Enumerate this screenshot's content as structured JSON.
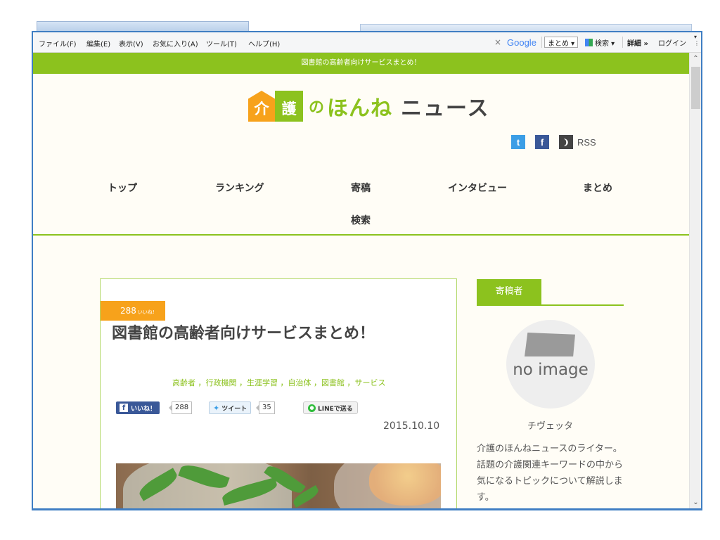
{
  "browser": {
    "menu": [
      "ファイル(F)",
      "編集(E)",
      "表示(V)",
      "お気に入り(A)",
      "ツール(T)",
      "ヘルプ(H)"
    ],
    "toolbar": {
      "close": "×",
      "google": "Google",
      "matome": "まとめ ▾",
      "search": "検索 ▾",
      "details": "詳細 »",
      "login": "ログイン"
    },
    "scroll_up": "⌃",
    "scroll_down": "⌄"
  },
  "site": {
    "top_bar": "図書館の高齢者向けサービスまとめ！",
    "logo": {
      "box1": "介",
      "box2": "護",
      "no": "の",
      "honne": "ほんね",
      "news": "ニュース"
    },
    "social": {
      "twitter": "t",
      "facebook": "f",
      "rss_icon": "❩",
      "rss_label": "RSS"
    },
    "nav": [
      "トップ",
      "ランキング",
      "寄稿",
      "インタビュー",
      "まとめ",
      "検索"
    ]
  },
  "article": {
    "likes_count": "288",
    "likes_label": "いいね!",
    "title": "図書館の高齢者向けサービスまとめ！",
    "tags": "高齢者 ，行政機関 ，生涯学習 ，自治体 ，図書館 ，サービス",
    "share": {
      "fb_label": "いいね！",
      "fb_count": "288",
      "tw_label": "ツイート",
      "tw_count": "35",
      "line_label": "LINEで送る"
    },
    "date": "2015.10.10"
  },
  "sidebar": {
    "heading": "寄稿者",
    "avatar_text": "no image",
    "author_name": "チヴェッタ",
    "author_desc": "介護のほんねニュースのライター。話題の介護関連キーワードの中から気になるトピックについて解説します。"
  },
  "colors": {
    "accent": "#8cc21e",
    "orange": "#f7a21b",
    "background": "#fffdf6"
  }
}
